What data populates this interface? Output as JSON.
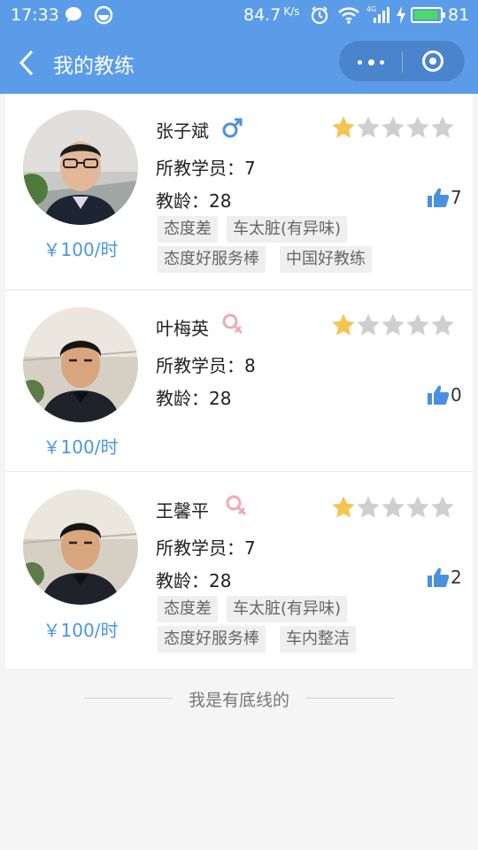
{
  "status_bar": {
    "time": "17:33",
    "speed": "84.7",
    "speed_unit": "K/s",
    "network": "4G",
    "battery": "81"
  },
  "navbar": {
    "title": "我的教练"
  },
  "labels": {
    "students": "所教学员：",
    "years": "教龄："
  },
  "coaches": [
    {
      "name": "张子斌",
      "gender_icon": "male-icon",
      "price": "￥100/时",
      "rating": 1,
      "students": "7",
      "years": "28",
      "likes": "7",
      "tags": [
        "态度差",
        "车太脏(有异味)",
        "态度好服务棒",
        "中国好教练"
      ]
    },
    {
      "name": "叶梅英",
      "gender_icon": "female-icon",
      "price": "￥100/时",
      "rating": 1,
      "students": "8",
      "years": "28",
      "likes": "0",
      "tags": []
    },
    {
      "name": "王馨平",
      "gender_icon": "female-icon",
      "price": "￥100/时",
      "rating": 1,
      "students": "7",
      "years": "28",
      "likes": "2",
      "tags": [
        "态度差",
        "车太脏(有异味)",
        "态度好服务棒",
        "车内整洁"
      ]
    }
  ],
  "footer": {
    "text": "我是有底线的"
  },
  "colors": {
    "header": "#5b9ce8",
    "accent": "#4a97e0",
    "star_on": "#f5c451",
    "star_off": "#cfcfcf",
    "male": "#4a90e2",
    "female": "#f2a8b5"
  }
}
